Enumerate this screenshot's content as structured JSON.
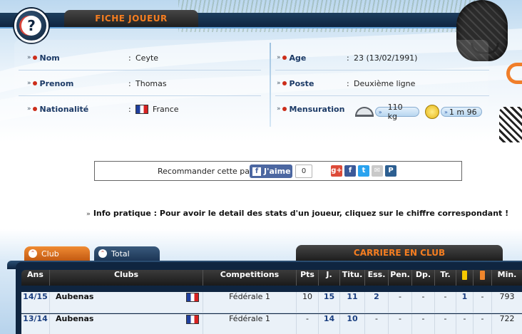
{
  "header": {
    "logo_glyph": "?",
    "title": "FICHE JOUEUR"
  },
  "player": {
    "left": [
      {
        "label": "Nom",
        "value": "Ceyte"
      },
      {
        "label": "Prenom",
        "value": "Thomas"
      },
      {
        "label": "Nationalité",
        "value": "France"
      }
    ],
    "right": [
      {
        "label": "Age",
        "value": "23  (13/02/1991)"
      },
      {
        "label": "Poste",
        "value": "Deuxième ligne"
      },
      {
        "label": "Mensuration",
        "weight": "110 kg",
        "height": "1 m 96"
      }
    ]
  },
  "recommend": {
    "text": "Recommander cette page",
    "like_label": "J'aime",
    "like_count": "0",
    "share_icons": [
      {
        "name": "google-plus-icon",
        "glyph": "g+",
        "color": "#dd4b39"
      },
      {
        "name": "facebook-icon",
        "glyph": "f",
        "color": "#3b5998"
      },
      {
        "name": "twitter-icon",
        "glyph": "t",
        "color": "#2aa3ef"
      },
      {
        "name": "email-icon",
        "glyph": "✉",
        "color": "#c9c9c9"
      },
      {
        "name": "print-icon",
        "glyph": "P",
        "color": "#2d5f91"
      }
    ]
  },
  "info_pratique": {
    "text": "Info pratique : Pour avoir le detail des stats d'un joueur, cliquez sur le chiffre correspondant !"
  },
  "career": {
    "tabs": [
      {
        "label": "Club",
        "active": true
      },
      {
        "label": "Total",
        "active": false
      }
    ],
    "title": "CARRIERE EN CLUB",
    "columns": [
      "Ans",
      "Clubs",
      "",
      "Competitions",
      "Pts",
      "J.",
      "Titu.",
      "Ess.",
      "Pen.",
      "Dp.",
      "Tr.",
      "",
      "",
      "Min."
    ],
    "card_colors": {
      "yellow": "#f6c800",
      "orange": "#f0862c"
    },
    "rows": [
      {
        "ans": "14/15",
        "club": "Aubenas",
        "competition": "Fédérale 1",
        "pts": "10",
        "j": "15",
        "titu": "11",
        "ess": "2",
        "pen": "-",
        "dp": "-",
        "tr": "-",
        "cy": "1",
        "co": "-",
        "min": "793"
      },
      {
        "ans": "13/14",
        "club": "Aubenas",
        "competition": "Fédérale 1",
        "pts": "-",
        "j": "14",
        "titu": "10",
        "ess": "-",
        "pen": "-",
        "dp": "-",
        "tr": "-",
        "cy": "-",
        "co": "-",
        "min": "722"
      }
    ]
  }
}
